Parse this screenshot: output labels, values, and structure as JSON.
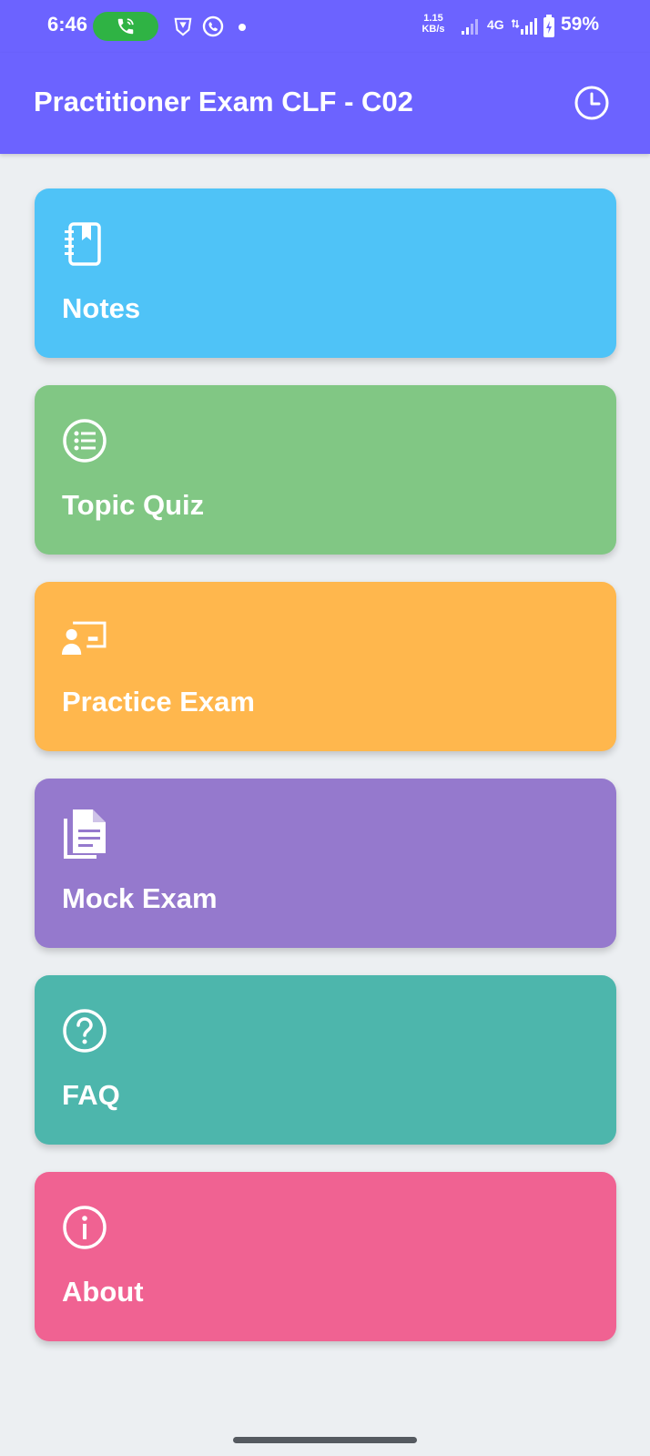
{
  "status_bar": {
    "time": "6:46",
    "net_speed_value": "1.15",
    "net_speed_unit": "KB/s",
    "network_type_1": "4G",
    "battery": "59%"
  },
  "app_bar": {
    "title": "Practitioner Exam CLF - C02",
    "history_icon": "clock-icon"
  },
  "menu": [
    {
      "label": "Notes",
      "icon": "notebook-icon",
      "color": "#4fc3f7"
    },
    {
      "label": "Topic Quiz",
      "icon": "list-icon",
      "color": "#81c784"
    },
    {
      "label": "Practice Exam",
      "icon": "presentation-icon",
      "color": "#ffb74d"
    },
    {
      "label": "Mock Exam",
      "icon": "document-icon",
      "color": "#9579cd"
    },
    {
      "label": "FAQ",
      "icon": "help-circle-icon",
      "color": "#4db6ac"
    },
    {
      "label": "About",
      "icon": "info-circle-icon",
      "color": "#f06292"
    }
  ]
}
